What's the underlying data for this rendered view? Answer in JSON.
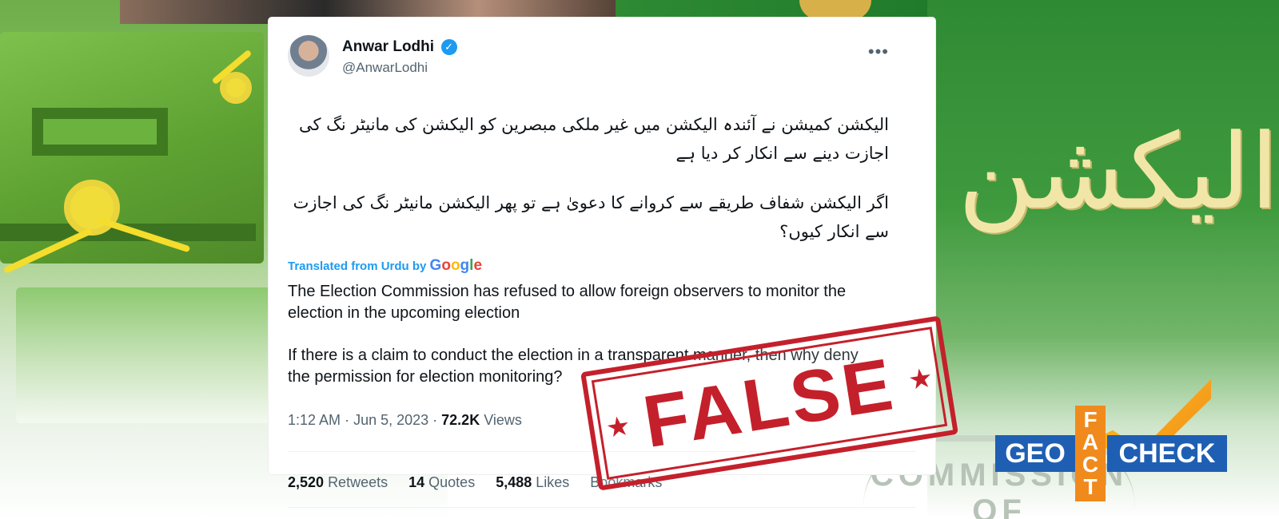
{
  "tweet": {
    "author": {
      "display_name": "Anwar Lodhi",
      "handle": "@AnwarLodhi",
      "verified": true
    },
    "urdu_text": [
      "الیکشن کمیشن نے آئندہ الیکشن میں غیر ملکی مبصرین کو الیکشن کی مانیٹر نگ کی اجازت دینے سے انکار کر دیا ہے",
      "اگر الیکشن شفاف طریقے سے کروانے کا دعویٰ ہے تو پھر الیکشن مانیٹر نگ کی اجازت سے انکار کیوں؟"
    ],
    "translated_label": "Translated from Urdu by",
    "translator_logo_text": "Google",
    "english_text": [
      "The Election Commission has refused to allow foreign observers to monitor the election in the upcoming election",
      "If there is a claim to conduct the election in a transparent manner, then why deny the permission for election monitoring?"
    ],
    "time": "1:12 AM",
    "date": "Jun 5, 2023",
    "views_count": "72.2K",
    "views_label": "Views",
    "stats": [
      {
        "count": "2,520",
        "label": "Retweets"
      },
      {
        "count": "14",
        "label": "Quotes"
      },
      {
        "count": "5,488",
        "label": "Likes"
      },
      {
        "count": "",
        "label": "Bookmarks"
      }
    ]
  },
  "stamp": {
    "text": "FALSE",
    "color": "#c4202b"
  },
  "logo": {
    "geo": "GEO",
    "fact": [
      "F",
      "A",
      "C",
      "T"
    ],
    "check": "CHECK",
    "colors": {
      "blue": "#1f5fb3",
      "orange": "#f08a1d",
      "yellow": "#ffc21a"
    }
  },
  "background": {
    "sign_text": "الیکشن کمیشن",
    "plaque_text": "COMMISSION OF"
  },
  "colors": {
    "link_blue": "#1d9bf0",
    "text_primary": "#0f1419",
    "text_secondary": "#536471"
  },
  "icons": {
    "verified": "verified-badge-icon",
    "more": "more-options-icon",
    "star": "star-icon"
  }
}
